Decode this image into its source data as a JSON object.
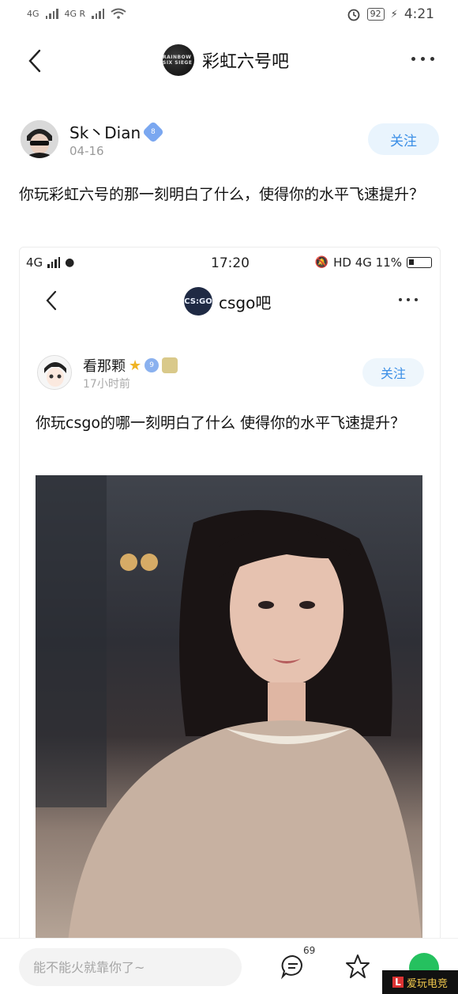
{
  "status_bar": {
    "left": [
      "4G",
      "4G R"
    ],
    "battery": "92",
    "time": "4:21"
  },
  "nav": {
    "forum_logo_text": "RAINBOW SIX SIEGE",
    "forum_title": "彩虹六号吧"
  },
  "post": {
    "author": "Sk丶Dian",
    "level": "8",
    "date": "04-16",
    "follow_label": "关注",
    "text": "你玩彩虹六号的那一刻明白了什么，使得你的水平飞速提升？"
  },
  "embedded": {
    "status": {
      "network": "4G",
      "time": "17:20",
      "right": "HD 4G 11%"
    },
    "forum_logo_text": "CS:GO",
    "forum_title": "csgo吧",
    "author": "看那颗",
    "level": "9",
    "time_ago": "17小时前",
    "follow_label": "关注",
    "text": "你玩csgo的哪一刻明白了什么 使得你的水平飞速提升？"
  },
  "bottom": {
    "reply_placeholder": "能不能火就靠你了~",
    "comment_count": "69",
    "corner_brand": "爱玩电竞"
  },
  "colors": {
    "accent": "#3a8ee6",
    "follow_bg": "#e9f4fd",
    "share_green": "#25c15f"
  }
}
